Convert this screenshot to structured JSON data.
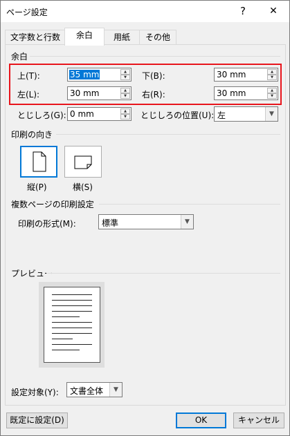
{
  "window": {
    "title": "ページ設定",
    "help": "?",
    "close": "✕"
  },
  "tabs": [
    "文字数と行数",
    "余白",
    "用紙",
    "その他"
  ],
  "margins": {
    "section_label": "余白",
    "top_label": "上(T):",
    "top_value": "35 mm",
    "bottom_label": "下(B):",
    "bottom_value": "30 mm",
    "left_label": "左(L):",
    "left_value": "30 mm",
    "right_label": "右(R):",
    "right_value": "30 mm",
    "gutter_label": "とじしろ(G):",
    "gutter_value": "0 mm",
    "gutter_pos_label": "とじしろの位置(U):",
    "gutter_pos_value": "左"
  },
  "orientation": {
    "section_label": "印刷の向き",
    "portrait_label": "縦(P)",
    "landscape_label": "横(S)",
    "selected": "portrait"
  },
  "multiple_pages": {
    "section_label": "複数ページの印刷設定",
    "format_label": "印刷の形式(M):",
    "format_value": "標準"
  },
  "preview": {
    "section_label": "プレビュー"
  },
  "apply_to": {
    "label": "設定対象(Y):",
    "value": "文書全体"
  },
  "buttons": {
    "set_default": "既定に設定(D)",
    "ok": "OK",
    "cancel": "キャンセル"
  },
  "colors": {
    "accent": "#0078d7",
    "highlight_box": "#e8141b"
  }
}
